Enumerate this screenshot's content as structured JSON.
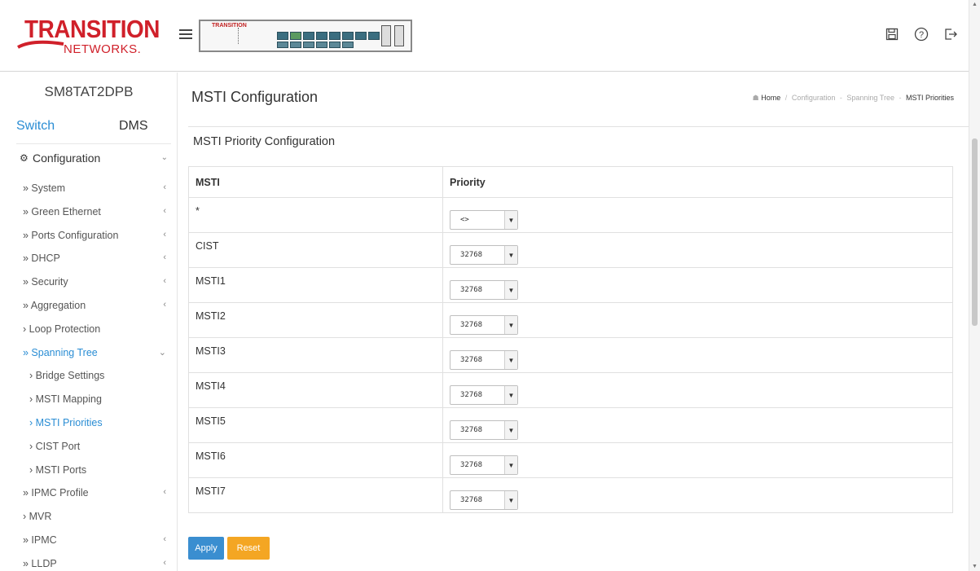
{
  "logo": {
    "main": "TRANSITION",
    "sub": "NETWORKS."
  },
  "device": {
    "label": "TRANSITION"
  },
  "sidebar": {
    "model": "SM8TAT2DPB",
    "tabs": [
      {
        "label": "Switch"
      },
      {
        "label": "DMS"
      }
    ],
    "config_label": "Configuration",
    "items": [
      {
        "label": "» System",
        "chevron": "‹"
      },
      {
        "label": "» Green Ethernet",
        "chevron": "‹"
      },
      {
        "label": "» Ports Configuration",
        "chevron": "‹"
      },
      {
        "label": "» DHCP",
        "chevron": "‹"
      },
      {
        "label": "» Security",
        "chevron": "‹"
      },
      {
        "label": "» Aggregation",
        "chevron": "‹"
      },
      {
        "label": "› Loop Protection",
        "chevron": ""
      },
      {
        "label": "» Spanning Tree",
        "chevron": "⌄"
      },
      {
        "label": "› Bridge Settings",
        "chevron": ""
      },
      {
        "label": "› MSTI Mapping",
        "chevron": ""
      },
      {
        "label": "› MSTI Priorities",
        "chevron": ""
      },
      {
        "label": "› CIST Port",
        "chevron": ""
      },
      {
        "label": "› MSTI Ports",
        "chevron": ""
      },
      {
        "label": "» IPMC Profile",
        "chevron": "‹"
      },
      {
        "label": "› MVR",
        "chevron": ""
      },
      {
        "label": "» IPMC",
        "chevron": "‹"
      },
      {
        "label": "» LLDP",
        "chevron": "‹"
      }
    ]
  },
  "main": {
    "title": "MSTI Configuration",
    "breadcrumb": {
      "home": "Home",
      "b1": "Configuration",
      "b2": "Spanning Tree",
      "current": "MSTI Priorities"
    },
    "section_title": "MSTI Priority Configuration",
    "table": {
      "headers": {
        "msti": "MSTI",
        "priority": "Priority"
      },
      "rows": [
        {
          "msti": "*",
          "priority": "<>"
        },
        {
          "msti": "CIST",
          "priority": "32768"
        },
        {
          "msti": "MSTI1",
          "priority": "32768"
        },
        {
          "msti": "MSTI2",
          "priority": "32768"
        },
        {
          "msti": "MSTI3",
          "priority": "32768"
        },
        {
          "msti": "MSTI4",
          "priority": "32768"
        },
        {
          "msti": "MSTI5",
          "priority": "32768"
        },
        {
          "msti": "MSTI6",
          "priority": "32768"
        },
        {
          "msti": "MSTI7",
          "priority": "32768"
        }
      ]
    },
    "buttons": {
      "apply": "Apply",
      "reset": "Reset"
    }
  },
  "colors": {
    "accent": "#2a8dd4",
    "apply": "#3a8ed0",
    "reset": "#f4a623",
    "brand": "#d0202a"
  }
}
